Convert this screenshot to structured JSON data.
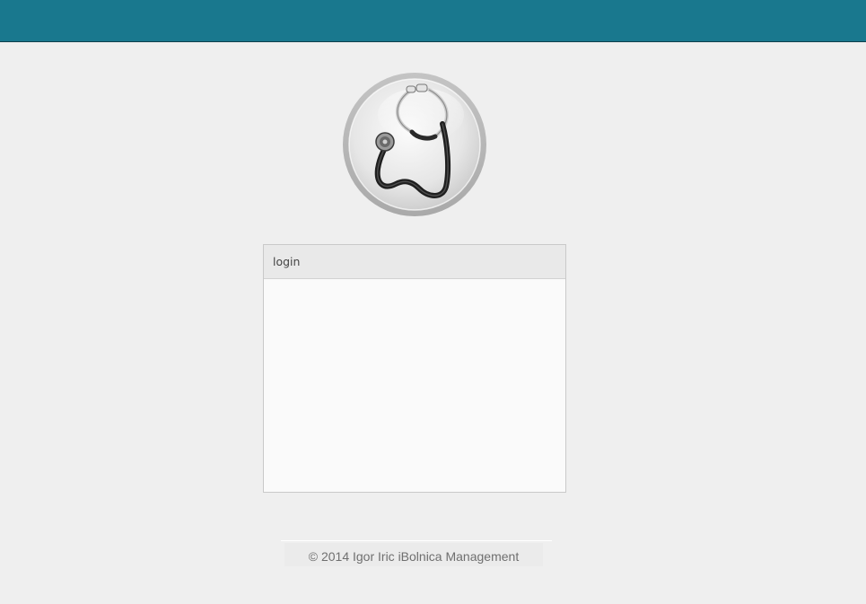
{
  "header": {
    "color": "#19788e"
  },
  "logo": {
    "icon": "stethoscope-icon"
  },
  "login_panel": {
    "title": "login"
  },
  "footer": {
    "text": "© 2014 Igor Iric iBolnica Management"
  }
}
